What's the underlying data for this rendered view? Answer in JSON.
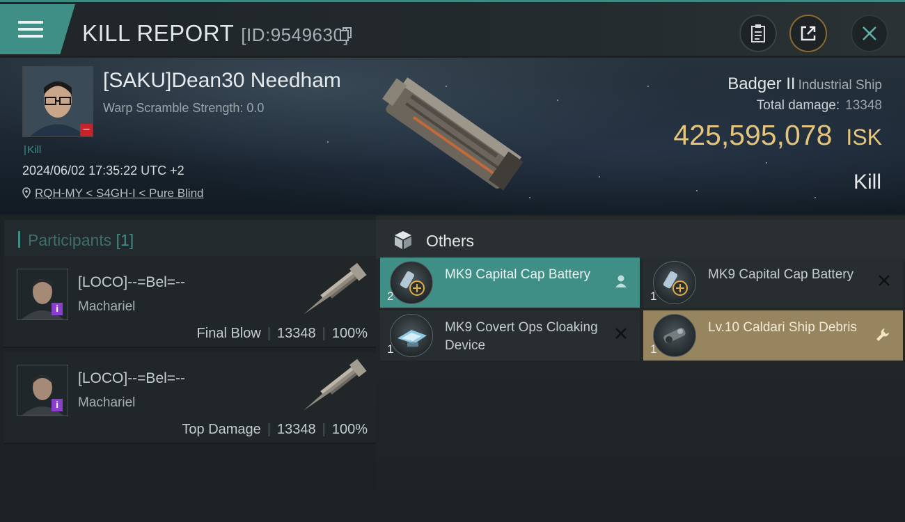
{
  "header": {
    "title": "KILL REPORT",
    "report_id": "[ID:9549630]"
  },
  "victim": {
    "name": "[SAKU]Dean30 Needham",
    "warp_scramble": "Warp Scramble Strength: 0.0",
    "tag": "Kill",
    "datetime": "2024/06/02 17:35:22 UTC +2",
    "location": "RQH-MY < S4GH-I < Pure Blind",
    "ship": "Badger II",
    "ship_class": "Industrial Ship",
    "total_damage_label": "Total damage:",
    "total_damage": "13348",
    "isk_value": "425,595,078",
    "isk_unit": "ISK",
    "kill_type": "Kill"
  },
  "participants": {
    "label": "Participants",
    "count": "[1]",
    "rows": [
      {
        "name": "[LOCO]--=Bel=--",
        "ship": "Machariel",
        "role": "Final Blow",
        "damage": "13348",
        "percent": "100%"
      },
      {
        "name": "[LOCO]--=Bel=--",
        "ship": "Machariel",
        "role": "Top Damage",
        "damage": "13348",
        "percent": "100%"
      }
    ]
  },
  "others": {
    "label": "Others",
    "items": [
      {
        "name": "MK9 Capital Cap Battery",
        "qty": "2",
        "status": "person-icon",
        "style": "teal"
      },
      {
        "name": "MK9 Capital Cap Battery",
        "qty": "1",
        "status": "x-icon",
        "style": "plain"
      },
      {
        "name": "MK9 Covert Ops Cloaking Device",
        "qty": "1",
        "status": "x-icon",
        "style": "plain"
      },
      {
        "name": "Lv.10 Caldari Ship Debris",
        "qty": "1",
        "status": "wrench-icon",
        "style": "gold"
      }
    ]
  },
  "colors": {
    "accent": "#3f8f86",
    "isk_gold": "#e5c47c",
    "loss_red": "#c9232b",
    "debris_gold": "#978560"
  }
}
